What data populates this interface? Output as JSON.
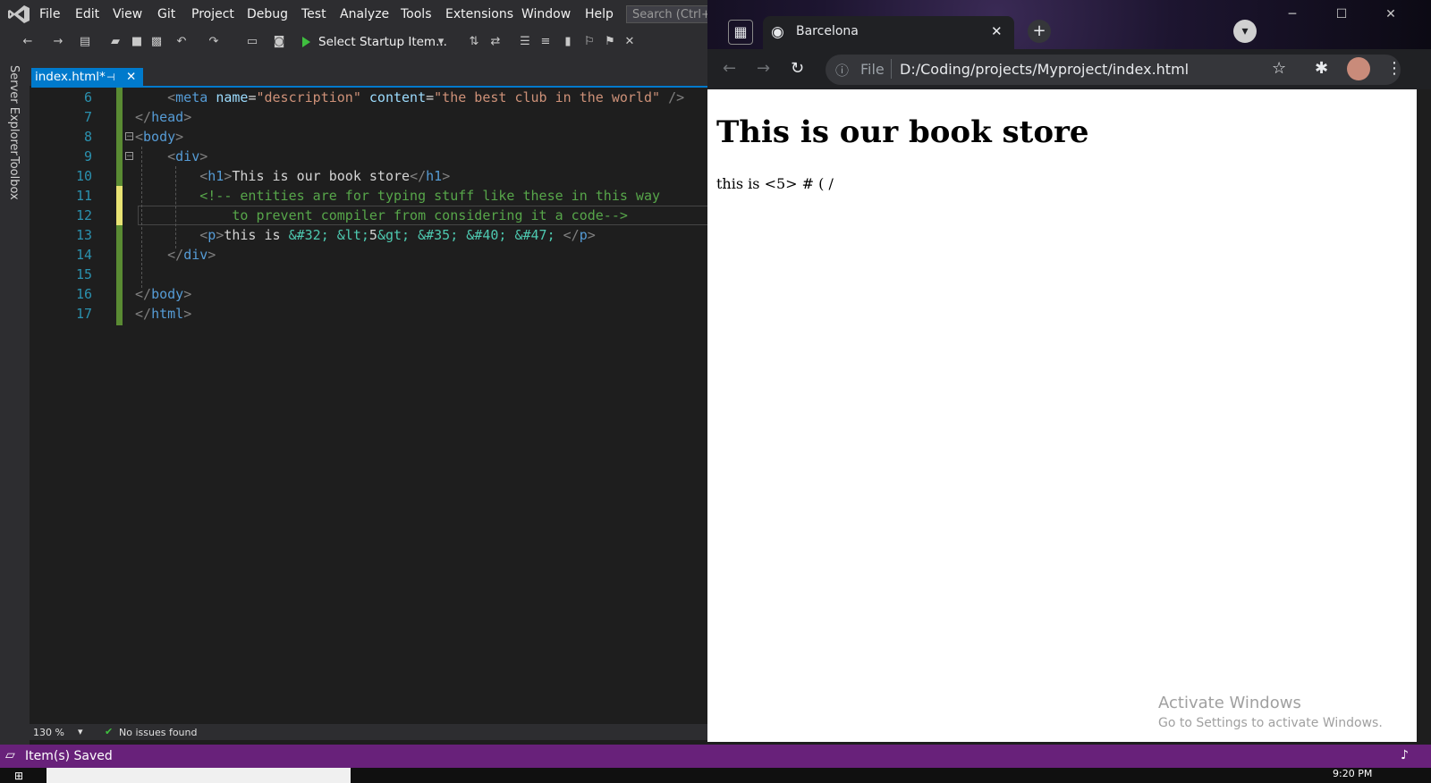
{
  "vs": {
    "menu": [
      "File",
      "Edit",
      "View",
      "Git",
      "Project",
      "Debug",
      "Test",
      "Analyze",
      "Tools",
      "Extensions",
      "Window",
      "Help"
    ],
    "search_placeholder": "Search (Ctrl+Q)",
    "startup_label": "Select Startup Item...",
    "rail": {
      "server_explorer": "Server Explorer",
      "toolbox": "Toolbox"
    },
    "tab": {
      "label": "index.html*"
    },
    "zoom": "130 %",
    "issues": "No issues found",
    "status": "Item(s) Saved",
    "lines": [
      {
        "n": "6",
        "parts": [
          [
            "tag-br",
            "    <"
          ],
          [
            "tag",
            "meta"
          ],
          [
            "code",
            " "
          ],
          [
            "attr",
            "name"
          ],
          [
            "code",
            "="
          ],
          [
            "str",
            "\"description\""
          ],
          [
            "code",
            " "
          ],
          [
            "attr",
            "content"
          ],
          [
            "code",
            "="
          ],
          [
            "str",
            "\"the best club in the world\""
          ],
          [
            "code",
            " "
          ],
          [
            "tag-br",
            "/>"
          ]
        ]
      },
      {
        "n": "7",
        "parts": [
          [
            "tag-br",
            "</"
          ],
          [
            "tag",
            "head"
          ],
          [
            "tag-br",
            ">"
          ]
        ]
      },
      {
        "n": "8",
        "parts": [
          [
            "tag-br",
            "<"
          ],
          [
            "tag",
            "body"
          ],
          [
            "tag-br",
            ">"
          ]
        ]
      },
      {
        "n": "9",
        "parts": [
          [
            "tag-br",
            "    <"
          ],
          [
            "tag",
            "div"
          ],
          [
            "tag-br",
            ">"
          ]
        ]
      },
      {
        "n": "10",
        "parts": [
          [
            "tag-br",
            "        <"
          ],
          [
            "tag",
            "h1"
          ],
          [
            "tag-br",
            ">"
          ],
          [
            "code",
            "This is our book store"
          ],
          [
            "tag-br",
            "</"
          ],
          [
            "tag",
            "h1"
          ],
          [
            "tag-br",
            ">"
          ]
        ]
      },
      {
        "n": "11",
        "parts": [
          [
            "cmt",
            "        <!-- entities are for typing stuff like these in this way"
          ]
        ]
      },
      {
        "n": "12",
        "parts": [
          [
            "cmt",
            "            to prevent compiler from considering it a code-->"
          ]
        ]
      },
      {
        "n": "13",
        "parts": [
          [
            "tag-br",
            "        <"
          ],
          [
            "tag",
            "p"
          ],
          [
            "tag-br",
            ">"
          ],
          [
            "code",
            "this is "
          ],
          [
            "ent",
            "&#32;"
          ],
          [
            "code",
            " "
          ],
          [
            "ent",
            "&lt;"
          ],
          [
            "code",
            "5"
          ],
          [
            "ent",
            "&gt;"
          ],
          [
            "code",
            " "
          ],
          [
            "ent",
            "&#35;"
          ],
          [
            "code",
            " "
          ],
          [
            "ent",
            "&#40;"
          ],
          [
            "code",
            " "
          ],
          [
            "ent",
            "&#47;"
          ],
          [
            "code",
            " "
          ],
          [
            "tag-br",
            "</"
          ],
          [
            "tag",
            "p"
          ],
          [
            "tag-br",
            ">"
          ]
        ]
      },
      {
        "n": "14",
        "parts": [
          [
            "tag-br",
            "    </"
          ],
          [
            "tag",
            "div"
          ],
          [
            "tag-br",
            ">"
          ]
        ]
      },
      {
        "n": "15",
        "parts": []
      },
      {
        "n": "16",
        "parts": [
          [
            "tag-br",
            "</"
          ],
          [
            "tag",
            "body"
          ],
          [
            "tag-br",
            ">"
          ]
        ]
      },
      {
        "n": "17",
        "parts": [
          [
            "tag-br",
            "</"
          ],
          [
            "tag",
            "html"
          ],
          [
            "tag-br",
            ">"
          ]
        ]
      }
    ]
  },
  "chrome": {
    "tab_title": "Barcelona",
    "file_label": "File",
    "url": "D:/Coding/projects/Myproject/index.html",
    "page": {
      "h1": "This is our book store",
      "p": "this is <5> # ( /"
    }
  },
  "watermark": {
    "line1": "Activate Windows",
    "line2": "Go to Settings to activate Windows."
  },
  "taskbar": {
    "time": "9:20 PM"
  },
  "colors": {
    "vs_accent": "#007acc",
    "vs_status": "#68217a",
    "git_added": "#5a8b33",
    "unsaved": "#e8e373"
  }
}
